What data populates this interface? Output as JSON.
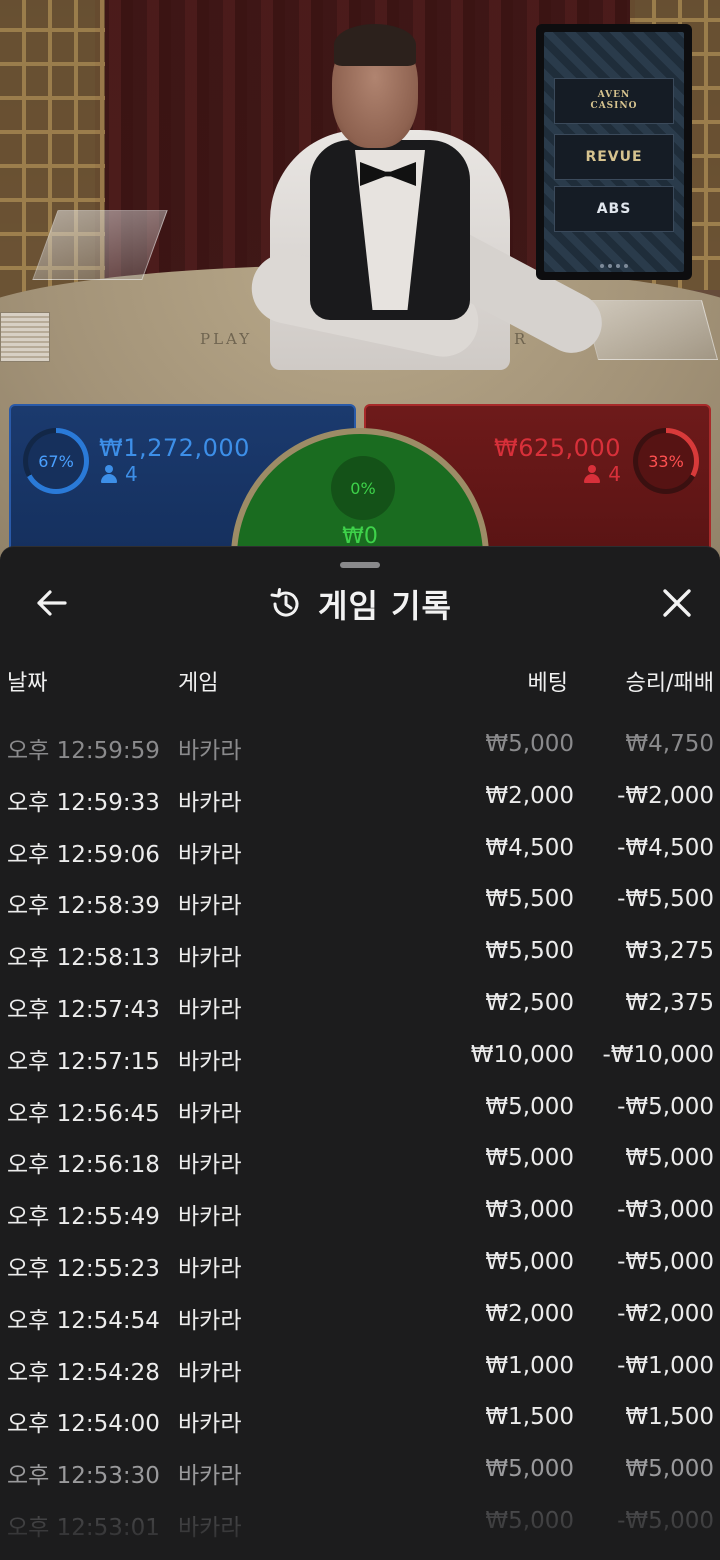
{
  "video": {
    "table_label_left": "PLAY",
    "table_label_right": "ER",
    "monitor": {
      "panel1_line1": "AVEN",
      "panel1_line2": "CASINO",
      "panel2": "REVUE",
      "panel3": "ABS"
    }
  },
  "betting": {
    "player": {
      "percent_label": "67%",
      "amount": "₩1,272,000",
      "players": "4",
      "fraction": 0.67,
      "color": "#3d8fe8"
    },
    "tie": {
      "percent_label": "0%",
      "amount": "₩0",
      "color": "#3ed24a"
    },
    "banker": {
      "percent_label": "33%",
      "amount": "₩625,000",
      "players": "4",
      "fraction": 0.33,
      "color": "#d8303a"
    }
  },
  "history": {
    "title": "게임 기록",
    "back_icon": "arrow-left-icon",
    "history_icon": "history-icon",
    "close_icon": "close-icon",
    "columns": {
      "date": "날짜",
      "game": "게임",
      "bet": "베팅",
      "result": "승리/패배"
    },
    "rows": [
      {
        "time": "오후 12:59:59",
        "game": "바카라",
        "bet": "₩5,000",
        "result": "₩4,750"
      },
      {
        "time": "오후 12:59:33",
        "game": "바카라",
        "bet": "₩2,000",
        "result": "-₩2,000"
      },
      {
        "time": "오후 12:59:06",
        "game": "바카라",
        "bet": "₩4,500",
        "result": "-₩4,500"
      },
      {
        "time": "오후 12:58:39",
        "game": "바카라",
        "bet": "₩5,500",
        "result": "-₩5,500"
      },
      {
        "time": "오후 12:58:13",
        "game": "바카라",
        "bet": "₩5,500",
        "result": "₩3,275"
      },
      {
        "time": "오후 12:57:43",
        "game": "바카라",
        "bet": "₩2,500",
        "result": "₩2,375"
      },
      {
        "time": "오후 12:57:15",
        "game": "바카라",
        "bet": "₩10,000",
        "result": "-₩10,000"
      },
      {
        "time": "오후 12:56:45",
        "game": "바카라",
        "bet": "₩5,000",
        "result": "-₩5,000"
      },
      {
        "time": "오후 12:56:18",
        "game": "바카라",
        "bet": "₩5,000",
        "result": "₩5,000"
      },
      {
        "time": "오후 12:55:49",
        "game": "바카라",
        "bet": "₩3,000",
        "result": "-₩3,000"
      },
      {
        "time": "오후 12:55:23",
        "game": "바카라",
        "bet": "₩5,000",
        "result": "-₩5,000"
      },
      {
        "time": "오후 12:54:54",
        "game": "바카라",
        "bet": "₩2,000",
        "result": "-₩2,000"
      },
      {
        "time": "오후 12:54:28",
        "game": "바카라",
        "bet": "₩1,000",
        "result": "-₩1,000"
      },
      {
        "time": "오후 12:54:00",
        "game": "바카라",
        "bet": "₩1,500",
        "result": "₩1,500"
      },
      {
        "time": "오후 12:53:30",
        "game": "바카라",
        "bet": "₩5,000",
        "result": "₩5,000"
      },
      {
        "time": "오후 12:53:01",
        "game": "바카라",
        "bet": "₩5,000",
        "result": "-₩5,000"
      }
    ]
  }
}
